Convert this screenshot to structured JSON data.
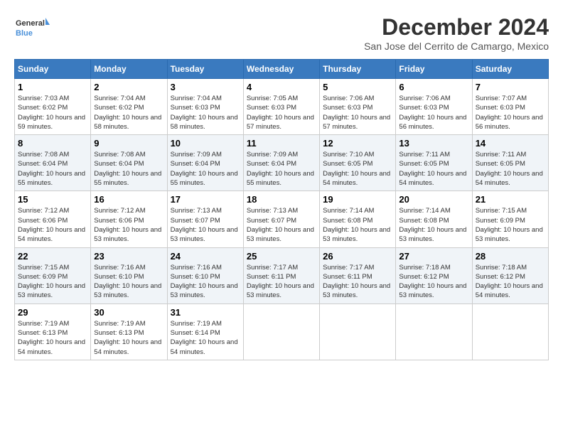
{
  "logo": {
    "text_general": "General",
    "text_blue": "Blue"
  },
  "title": "December 2024",
  "subtitle": "San Jose del Cerrito de Camargo, Mexico",
  "weekdays": [
    "Sunday",
    "Monday",
    "Tuesday",
    "Wednesday",
    "Thursday",
    "Friday",
    "Saturday"
  ],
  "weeks": [
    [
      {
        "day": "1",
        "sunrise": "Sunrise: 7:03 AM",
        "sunset": "Sunset: 6:02 PM",
        "daylight": "Daylight: 10 hours and 59 minutes."
      },
      {
        "day": "2",
        "sunrise": "Sunrise: 7:04 AM",
        "sunset": "Sunset: 6:02 PM",
        "daylight": "Daylight: 10 hours and 58 minutes."
      },
      {
        "day": "3",
        "sunrise": "Sunrise: 7:04 AM",
        "sunset": "Sunset: 6:03 PM",
        "daylight": "Daylight: 10 hours and 58 minutes."
      },
      {
        "day": "4",
        "sunrise": "Sunrise: 7:05 AM",
        "sunset": "Sunset: 6:03 PM",
        "daylight": "Daylight: 10 hours and 57 minutes."
      },
      {
        "day": "5",
        "sunrise": "Sunrise: 7:06 AM",
        "sunset": "Sunset: 6:03 PM",
        "daylight": "Daylight: 10 hours and 57 minutes."
      },
      {
        "day": "6",
        "sunrise": "Sunrise: 7:06 AM",
        "sunset": "Sunset: 6:03 PM",
        "daylight": "Daylight: 10 hours and 56 minutes."
      },
      {
        "day": "7",
        "sunrise": "Sunrise: 7:07 AM",
        "sunset": "Sunset: 6:03 PM",
        "daylight": "Daylight: 10 hours and 56 minutes."
      }
    ],
    [
      {
        "day": "8",
        "sunrise": "Sunrise: 7:08 AM",
        "sunset": "Sunset: 6:04 PM",
        "daylight": "Daylight: 10 hours and 55 minutes."
      },
      {
        "day": "9",
        "sunrise": "Sunrise: 7:08 AM",
        "sunset": "Sunset: 6:04 PM",
        "daylight": "Daylight: 10 hours and 55 minutes."
      },
      {
        "day": "10",
        "sunrise": "Sunrise: 7:09 AM",
        "sunset": "Sunset: 6:04 PM",
        "daylight": "Daylight: 10 hours and 55 minutes."
      },
      {
        "day": "11",
        "sunrise": "Sunrise: 7:09 AM",
        "sunset": "Sunset: 6:04 PM",
        "daylight": "Daylight: 10 hours and 55 minutes."
      },
      {
        "day": "12",
        "sunrise": "Sunrise: 7:10 AM",
        "sunset": "Sunset: 6:05 PM",
        "daylight": "Daylight: 10 hours and 54 minutes."
      },
      {
        "day": "13",
        "sunrise": "Sunrise: 7:11 AM",
        "sunset": "Sunset: 6:05 PM",
        "daylight": "Daylight: 10 hours and 54 minutes."
      },
      {
        "day": "14",
        "sunrise": "Sunrise: 7:11 AM",
        "sunset": "Sunset: 6:05 PM",
        "daylight": "Daylight: 10 hours and 54 minutes."
      }
    ],
    [
      {
        "day": "15",
        "sunrise": "Sunrise: 7:12 AM",
        "sunset": "Sunset: 6:06 PM",
        "daylight": "Daylight: 10 hours and 54 minutes."
      },
      {
        "day": "16",
        "sunrise": "Sunrise: 7:12 AM",
        "sunset": "Sunset: 6:06 PM",
        "daylight": "Daylight: 10 hours and 53 minutes."
      },
      {
        "day": "17",
        "sunrise": "Sunrise: 7:13 AM",
        "sunset": "Sunset: 6:07 PM",
        "daylight": "Daylight: 10 hours and 53 minutes."
      },
      {
        "day": "18",
        "sunrise": "Sunrise: 7:13 AM",
        "sunset": "Sunset: 6:07 PM",
        "daylight": "Daylight: 10 hours and 53 minutes."
      },
      {
        "day": "19",
        "sunrise": "Sunrise: 7:14 AM",
        "sunset": "Sunset: 6:08 PM",
        "daylight": "Daylight: 10 hours and 53 minutes."
      },
      {
        "day": "20",
        "sunrise": "Sunrise: 7:14 AM",
        "sunset": "Sunset: 6:08 PM",
        "daylight": "Daylight: 10 hours and 53 minutes."
      },
      {
        "day": "21",
        "sunrise": "Sunrise: 7:15 AM",
        "sunset": "Sunset: 6:09 PM",
        "daylight": "Daylight: 10 hours and 53 minutes."
      }
    ],
    [
      {
        "day": "22",
        "sunrise": "Sunrise: 7:15 AM",
        "sunset": "Sunset: 6:09 PM",
        "daylight": "Daylight: 10 hours and 53 minutes."
      },
      {
        "day": "23",
        "sunrise": "Sunrise: 7:16 AM",
        "sunset": "Sunset: 6:10 PM",
        "daylight": "Daylight: 10 hours and 53 minutes."
      },
      {
        "day": "24",
        "sunrise": "Sunrise: 7:16 AM",
        "sunset": "Sunset: 6:10 PM",
        "daylight": "Daylight: 10 hours and 53 minutes."
      },
      {
        "day": "25",
        "sunrise": "Sunrise: 7:17 AM",
        "sunset": "Sunset: 6:11 PM",
        "daylight": "Daylight: 10 hours and 53 minutes."
      },
      {
        "day": "26",
        "sunrise": "Sunrise: 7:17 AM",
        "sunset": "Sunset: 6:11 PM",
        "daylight": "Daylight: 10 hours and 53 minutes."
      },
      {
        "day": "27",
        "sunrise": "Sunrise: 7:18 AM",
        "sunset": "Sunset: 6:12 PM",
        "daylight": "Daylight: 10 hours and 53 minutes."
      },
      {
        "day": "28",
        "sunrise": "Sunrise: 7:18 AM",
        "sunset": "Sunset: 6:12 PM",
        "daylight": "Daylight: 10 hours and 54 minutes."
      }
    ],
    [
      {
        "day": "29",
        "sunrise": "Sunrise: 7:19 AM",
        "sunset": "Sunset: 6:13 PM",
        "daylight": "Daylight: 10 hours and 54 minutes."
      },
      {
        "day": "30",
        "sunrise": "Sunrise: 7:19 AM",
        "sunset": "Sunset: 6:13 PM",
        "daylight": "Daylight: 10 hours and 54 minutes."
      },
      {
        "day": "31",
        "sunrise": "Sunrise: 7:19 AM",
        "sunset": "Sunset: 6:14 PM",
        "daylight": "Daylight: 10 hours and 54 minutes."
      },
      null,
      null,
      null,
      null
    ]
  ]
}
